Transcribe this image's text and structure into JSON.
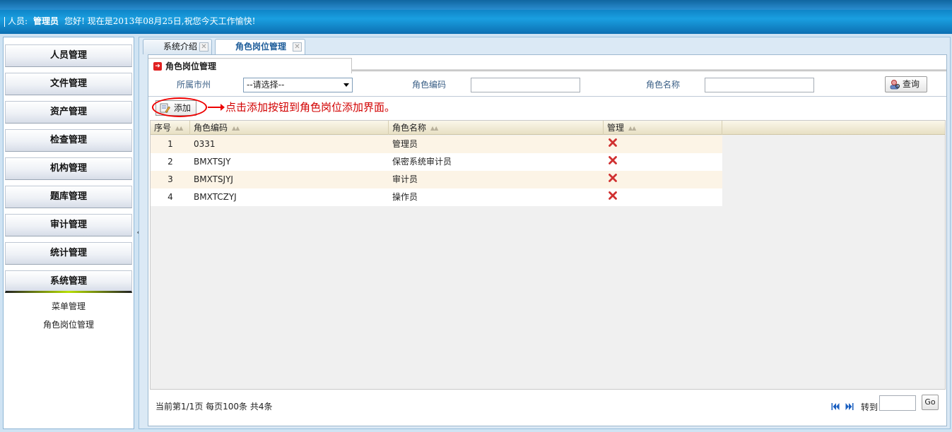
{
  "header": {
    "user_label": "人员:",
    "user_name": "管理员",
    "greeting": "您好!   现在是2013年08月25日,祝您今天工作愉快!"
  },
  "sidebar": {
    "items": [
      {
        "label": "人员管理"
      },
      {
        "label": "文件管理"
      },
      {
        "label": "资产管理"
      },
      {
        "label": "检查管理"
      },
      {
        "label": "机构管理"
      },
      {
        "label": "题库管理"
      },
      {
        "label": "审计管理"
      },
      {
        "label": "统计管理"
      },
      {
        "label": "系统管理"
      }
    ],
    "submenu": [
      {
        "label": "菜单管理"
      },
      {
        "label": "角色岗位管理"
      }
    ],
    "collapse_glyph": "«"
  },
  "tabs": [
    {
      "label": "系统介绍"
    },
    {
      "label": "角色岗位管理"
    }
  ],
  "panel": {
    "title": "角色岗位管理"
  },
  "filter": {
    "city_label": "所属市州",
    "city_value": "--请选择--",
    "code_label": "角色编码",
    "name_label": "角色名称",
    "query_label": "查询"
  },
  "toolbar": {
    "add_label": "添加",
    "annotation": "点击添加按钮到角色岗位添加界面。"
  },
  "table": {
    "columns": [
      "序号",
      "角色编码",
      "角色名称",
      "管理"
    ],
    "rows": [
      {
        "index": "1",
        "code": "0331",
        "name": "管理员"
      },
      {
        "index": "2",
        "code": "BMXTSJY",
        "name": "保密系统审计员"
      },
      {
        "index": "3",
        "code": "BMXTSJYJ",
        "name": "审计员"
      },
      {
        "index": "4",
        "code": "BMXTCZYJ",
        "name": "操作员"
      }
    ]
  },
  "pagination": {
    "info": "当前第1/1页  每页100条  共4条",
    "goto_label": "转到",
    "go_label": "Go"
  },
  "colors": {
    "accent": "#1a9fe0",
    "danger": "#d20000",
    "delete_icon": "#d03030"
  }
}
